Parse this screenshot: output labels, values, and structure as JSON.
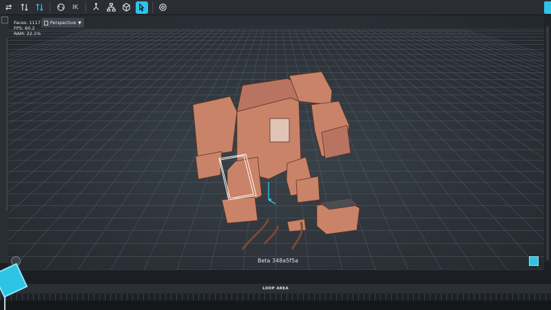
{
  "toolbar": {
    "buttons": [
      {
        "name": "transform-icon"
      },
      {
        "name": "move-icon"
      },
      {
        "name": "rotate-icon"
      },
      {
        "name": "sync-icon"
      },
      {
        "name": "ik-toggle"
      },
      {
        "name": "bone-icon"
      },
      {
        "name": "tree-icon"
      },
      {
        "name": "cube-icon"
      },
      {
        "name": "select-icon"
      },
      {
        "name": "target-icon"
      }
    ],
    "ik_label": "IK",
    "active_color": "#2ec4e6"
  },
  "viewport": {
    "stats": {
      "faces": "Faces: 1117",
      "fps": "FPS: 60.2",
      "ram": "RAM: 22.1%"
    },
    "view_mode": "Perspective",
    "version_text": "Beta 348a5f5a"
  },
  "timeline": {
    "loop_label": "LOOP AREA"
  },
  "colors": {
    "accent": "#2ec4e6",
    "robot": "#c98368",
    "grid": "#6a7682"
  }
}
